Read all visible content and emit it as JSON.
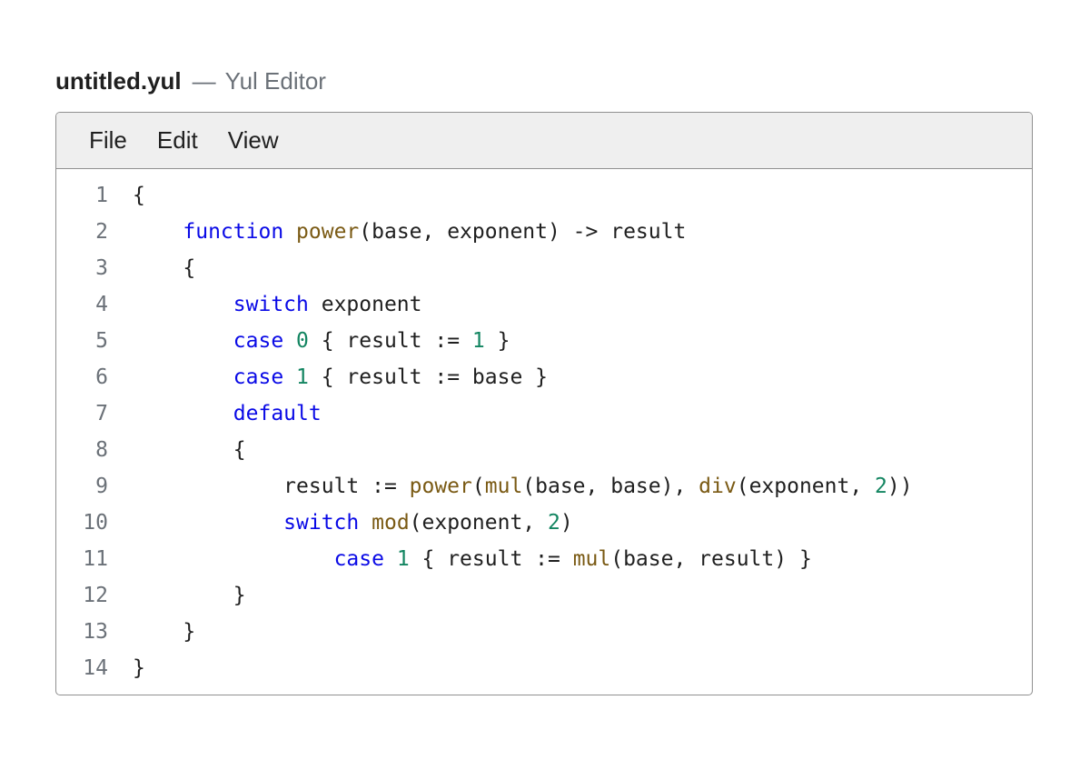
{
  "window": {
    "file_name": "untitled.yul",
    "separator": "—",
    "app_name": "Yul Editor"
  },
  "menu": {
    "items": [
      {
        "label": "File"
      },
      {
        "label": "Edit"
      },
      {
        "label": "View"
      }
    ]
  },
  "colors": {
    "keyword": "#0a0ae6",
    "function": "#7a5a14",
    "number": "#138561",
    "plain": "#1f1f1f",
    "line_number": "#6b7178"
  },
  "code": {
    "lines": [
      {
        "number": "1",
        "tokens": [
          {
            "t": "plain",
            "v": "{"
          }
        ]
      },
      {
        "number": "2",
        "tokens": [
          {
            "t": "plain",
            "v": "    "
          },
          {
            "t": "kw",
            "v": "function"
          },
          {
            "t": "plain",
            "v": " "
          },
          {
            "t": "fn",
            "v": "power"
          },
          {
            "t": "plain",
            "v": "(base, exponent) -> result"
          }
        ]
      },
      {
        "number": "3",
        "tokens": [
          {
            "t": "plain",
            "v": "    {"
          }
        ]
      },
      {
        "number": "4",
        "tokens": [
          {
            "t": "plain",
            "v": "        "
          },
          {
            "t": "kw",
            "v": "switch"
          },
          {
            "t": "plain",
            "v": " exponent"
          }
        ]
      },
      {
        "number": "5",
        "tokens": [
          {
            "t": "plain",
            "v": "        "
          },
          {
            "t": "kw",
            "v": "case"
          },
          {
            "t": "plain",
            "v": " "
          },
          {
            "t": "num",
            "v": "0"
          },
          {
            "t": "plain",
            "v": " { result := "
          },
          {
            "t": "num",
            "v": "1"
          },
          {
            "t": "plain",
            "v": " }"
          }
        ]
      },
      {
        "number": "6",
        "tokens": [
          {
            "t": "plain",
            "v": "        "
          },
          {
            "t": "kw",
            "v": "case"
          },
          {
            "t": "plain",
            "v": " "
          },
          {
            "t": "num",
            "v": "1"
          },
          {
            "t": "plain",
            "v": " { result := base }"
          }
        ]
      },
      {
        "number": "7",
        "tokens": [
          {
            "t": "plain",
            "v": "        "
          },
          {
            "t": "kw",
            "v": "default"
          }
        ]
      },
      {
        "number": "8",
        "tokens": [
          {
            "t": "plain",
            "v": "        {"
          }
        ]
      },
      {
        "number": "9",
        "tokens": [
          {
            "t": "plain",
            "v": "            result := "
          },
          {
            "t": "fn",
            "v": "power"
          },
          {
            "t": "plain",
            "v": "("
          },
          {
            "t": "fn",
            "v": "mul"
          },
          {
            "t": "plain",
            "v": "(base, base), "
          },
          {
            "t": "fn",
            "v": "div"
          },
          {
            "t": "plain",
            "v": "(exponent, "
          },
          {
            "t": "num",
            "v": "2"
          },
          {
            "t": "plain",
            "v": "))"
          }
        ]
      },
      {
        "number": "10",
        "tokens": [
          {
            "t": "plain",
            "v": "            "
          },
          {
            "t": "kw",
            "v": "switch"
          },
          {
            "t": "plain",
            "v": " "
          },
          {
            "t": "fn",
            "v": "mod"
          },
          {
            "t": "plain",
            "v": "(exponent, "
          },
          {
            "t": "num",
            "v": "2"
          },
          {
            "t": "plain",
            "v": ")"
          }
        ]
      },
      {
        "number": "11",
        "tokens": [
          {
            "t": "plain",
            "v": "                "
          },
          {
            "t": "kw",
            "v": "case"
          },
          {
            "t": "plain",
            "v": " "
          },
          {
            "t": "num",
            "v": "1"
          },
          {
            "t": "plain",
            "v": " { result := "
          },
          {
            "t": "fn",
            "v": "mul"
          },
          {
            "t": "plain",
            "v": "(base, result) }"
          }
        ]
      },
      {
        "number": "12",
        "tokens": [
          {
            "t": "plain",
            "v": "        }"
          }
        ]
      },
      {
        "number": "13",
        "tokens": [
          {
            "t": "plain",
            "v": "    }"
          }
        ]
      },
      {
        "number": "14",
        "tokens": [
          {
            "t": "plain",
            "v": "}"
          }
        ]
      }
    ]
  }
}
